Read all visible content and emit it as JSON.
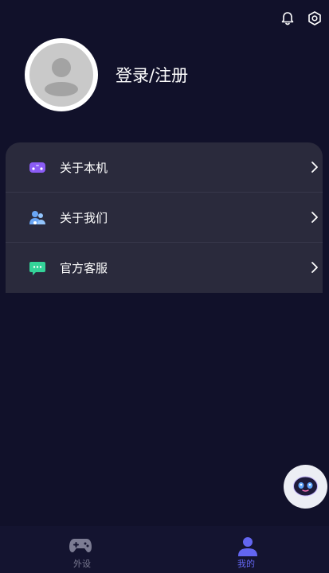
{
  "header": {
    "notification_icon": "bell-icon",
    "settings_icon": "gear-icon"
  },
  "profile": {
    "login_label": "登录/注册",
    "avatar_icon": "default-avatar-icon"
  },
  "menu": {
    "items": [
      {
        "label": "关于本机",
        "icon": "gamepad-icon",
        "color": "#8b5cf6"
      },
      {
        "label": "关于我们",
        "icon": "users-icon",
        "color": "#6aa6f5"
      },
      {
        "label": "官方客服",
        "icon": "chat-icon",
        "color": "#34d399"
      }
    ]
  },
  "assistant": {
    "icon": "robot-icon"
  },
  "tabbar": {
    "tabs": [
      {
        "label": "外设",
        "icon": "gamepad-icon",
        "active": false
      },
      {
        "label": "我的",
        "icon": "user-icon",
        "active": true
      }
    ],
    "active_color": "#6366f1",
    "inactive_color": "#7c7c93"
  },
  "colors": {
    "background": "#11112a",
    "card": "#2a2a3c",
    "accent": "#6366f1"
  }
}
